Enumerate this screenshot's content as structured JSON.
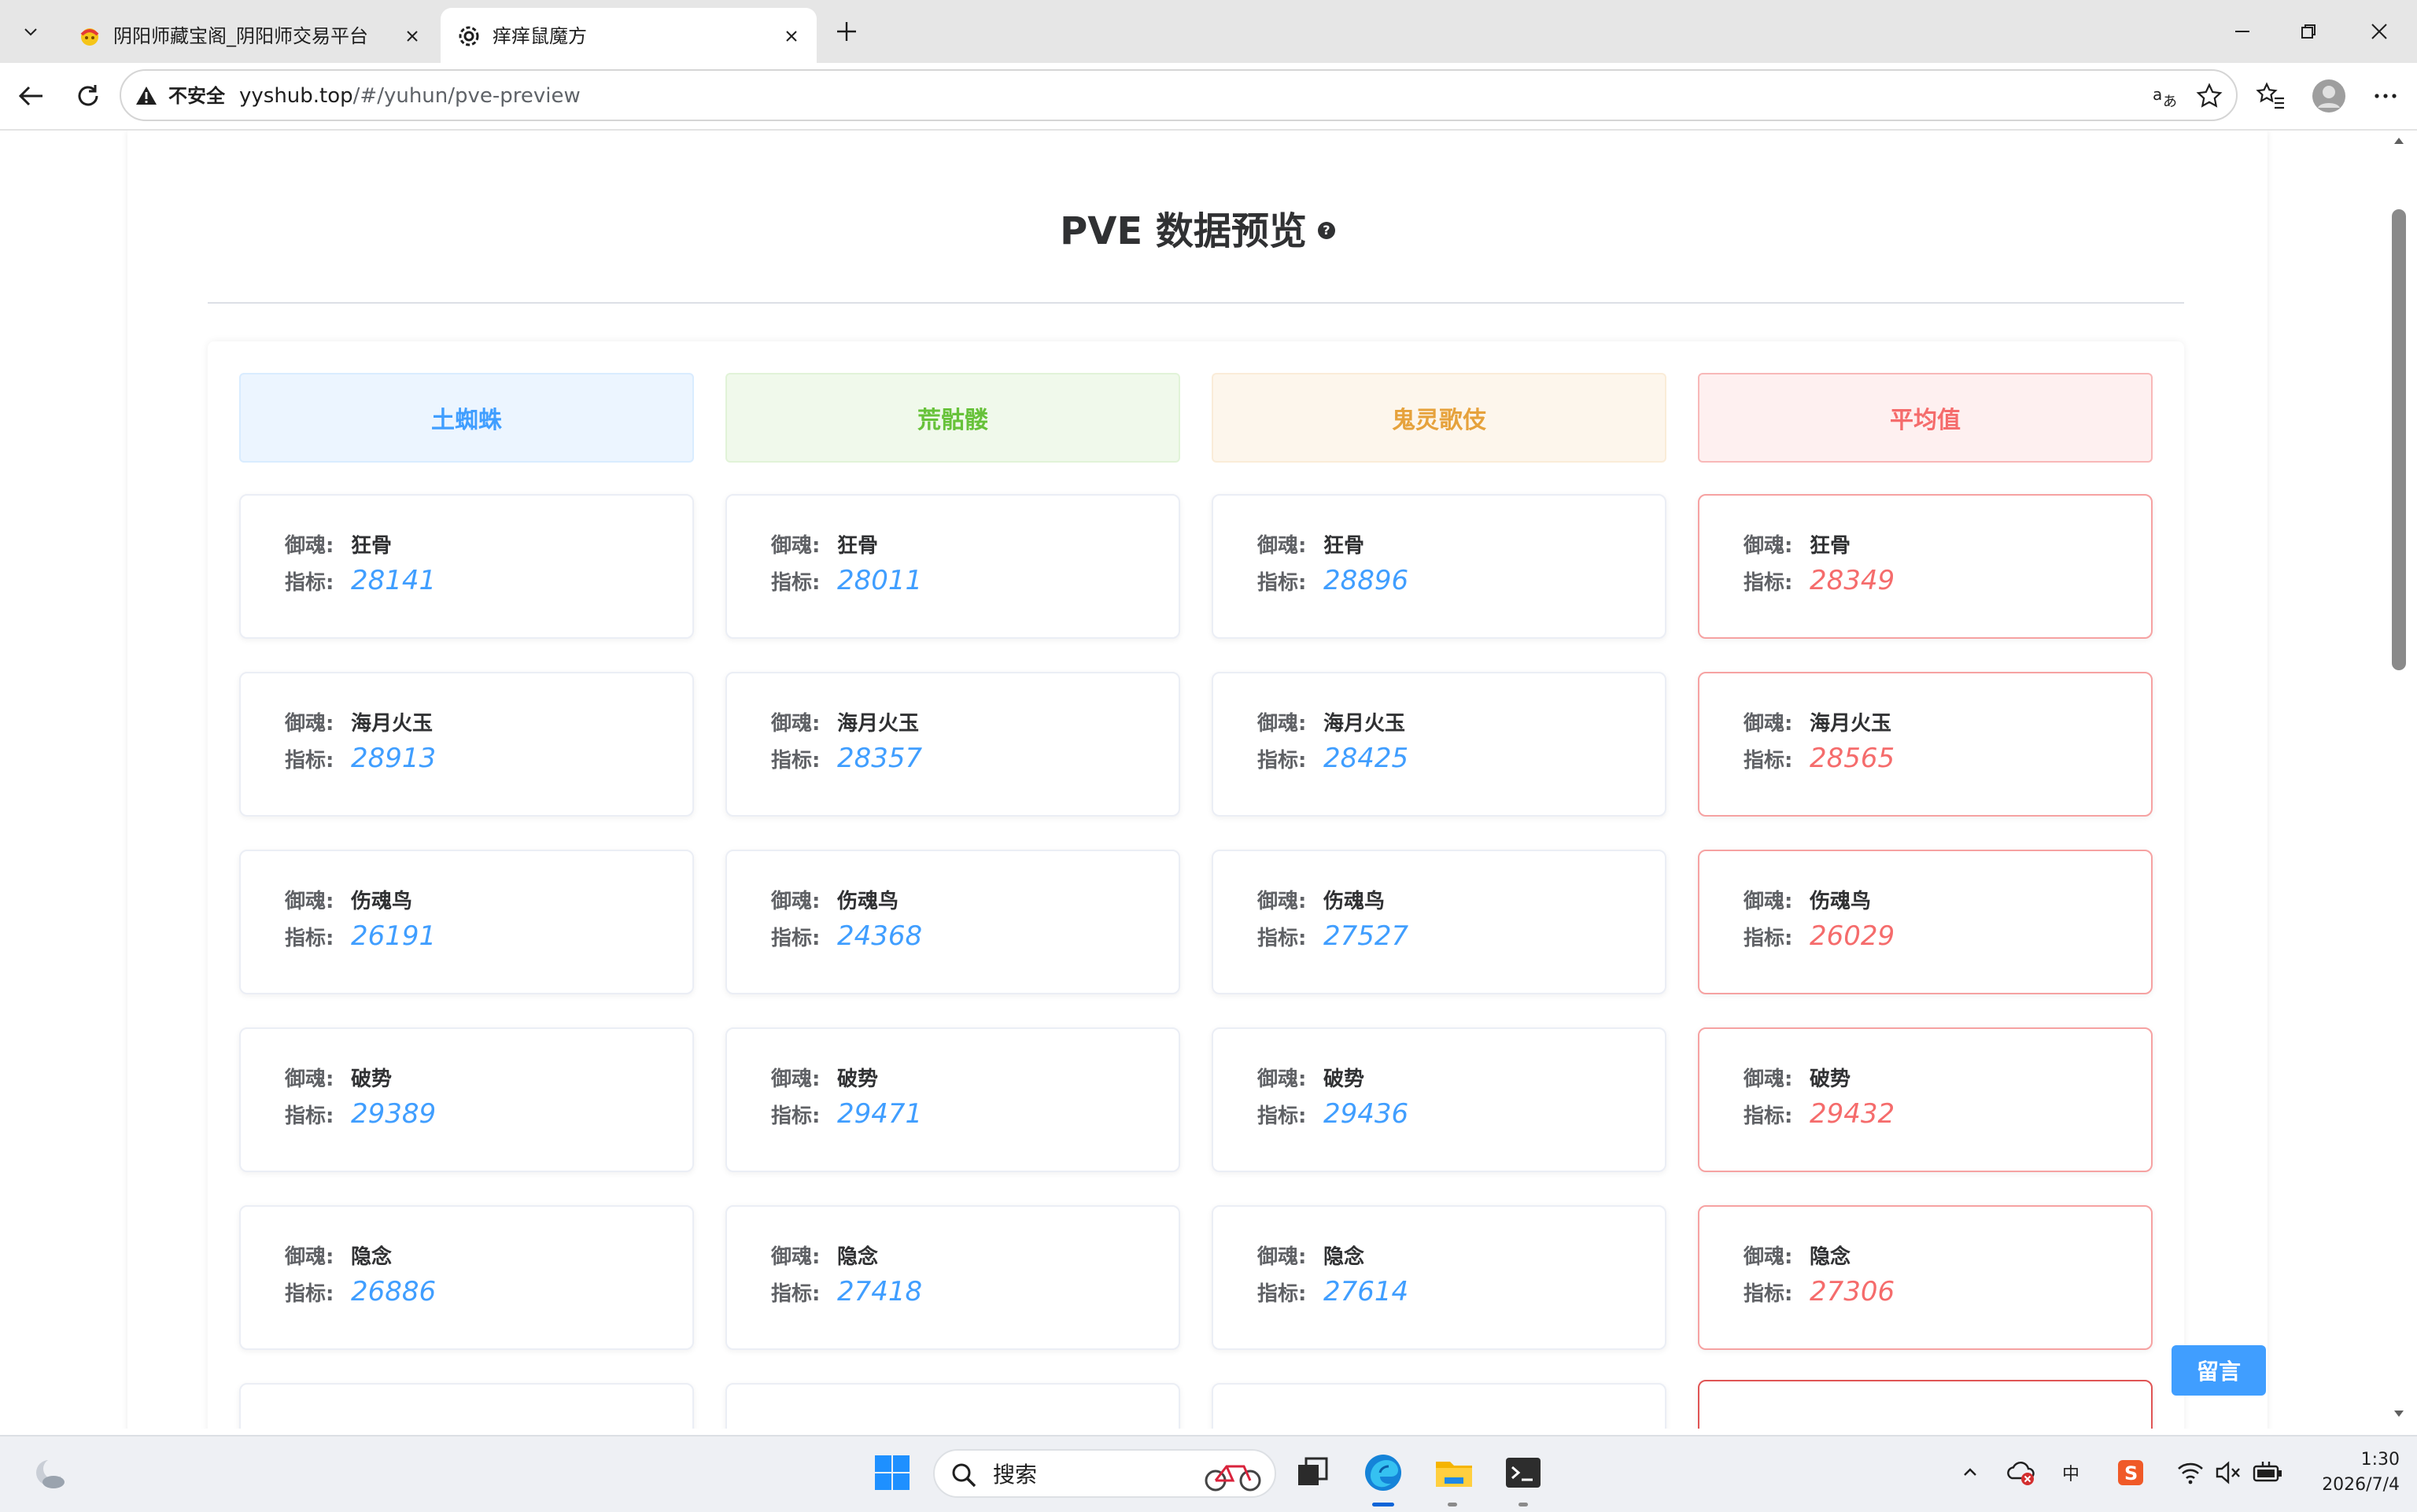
{
  "browser": {
    "tabs": [
      {
        "title": "阴阳师藏宝阁_阴阳师交易平台",
        "active": false
      },
      {
        "title": "痒痒鼠魔方",
        "active": true
      }
    ],
    "security_label": "不安全",
    "url_host": "yyshub.top",
    "url_path": "/#/yuhun/pve-preview"
  },
  "page": {
    "title": "PVE 数据预览",
    "help_icon": "?",
    "labels": {
      "yuhun": "御魂:",
      "metric": "指标:"
    },
    "message_button": "留言"
  },
  "colors": {
    "blue": "#409eff",
    "green": "#67c23a",
    "orange": "#e6a23c",
    "red": "#f56c6c"
  },
  "columns": [
    {
      "name": "土蜘蛛",
      "rows": [
        {
          "yuhun": "狂骨",
          "metric": "28141"
        },
        {
          "yuhun": "海月火玉",
          "metric": "28913"
        },
        {
          "yuhun": "伤魂鸟",
          "metric": "26191"
        },
        {
          "yuhun": "破势",
          "metric": "29389"
        },
        {
          "yuhun": "隐念",
          "metric": "26886"
        }
      ]
    },
    {
      "name": "荒骷髅",
      "rows": [
        {
          "yuhun": "狂骨",
          "metric": "28011"
        },
        {
          "yuhun": "海月火玉",
          "metric": "28357"
        },
        {
          "yuhun": "伤魂鸟",
          "metric": "24368"
        },
        {
          "yuhun": "破势",
          "metric": "29471"
        },
        {
          "yuhun": "隐念",
          "metric": "27418"
        }
      ]
    },
    {
      "name": "鬼灵歌伎",
      "rows": [
        {
          "yuhun": "狂骨",
          "metric": "28896"
        },
        {
          "yuhun": "海月火玉",
          "metric": "28425"
        },
        {
          "yuhun": "伤魂鸟",
          "metric": "27527"
        },
        {
          "yuhun": "破势",
          "metric": "29436"
        },
        {
          "yuhun": "隐念",
          "metric": "27614"
        }
      ]
    },
    {
      "name": "平均值",
      "rows": [
        {
          "yuhun": "狂骨",
          "metric": "28349"
        },
        {
          "yuhun": "海月火玉",
          "metric": "28565"
        },
        {
          "yuhun": "伤魂鸟",
          "metric": "26029"
        },
        {
          "yuhun": "破势",
          "metric": "29432"
        },
        {
          "yuhun": "隐念",
          "metric": "27306"
        }
      ]
    }
  ],
  "taskbar": {
    "search_placeholder": "搜索",
    "time": "1:30",
    "date": "2026/7/4",
    "ime": "中"
  }
}
